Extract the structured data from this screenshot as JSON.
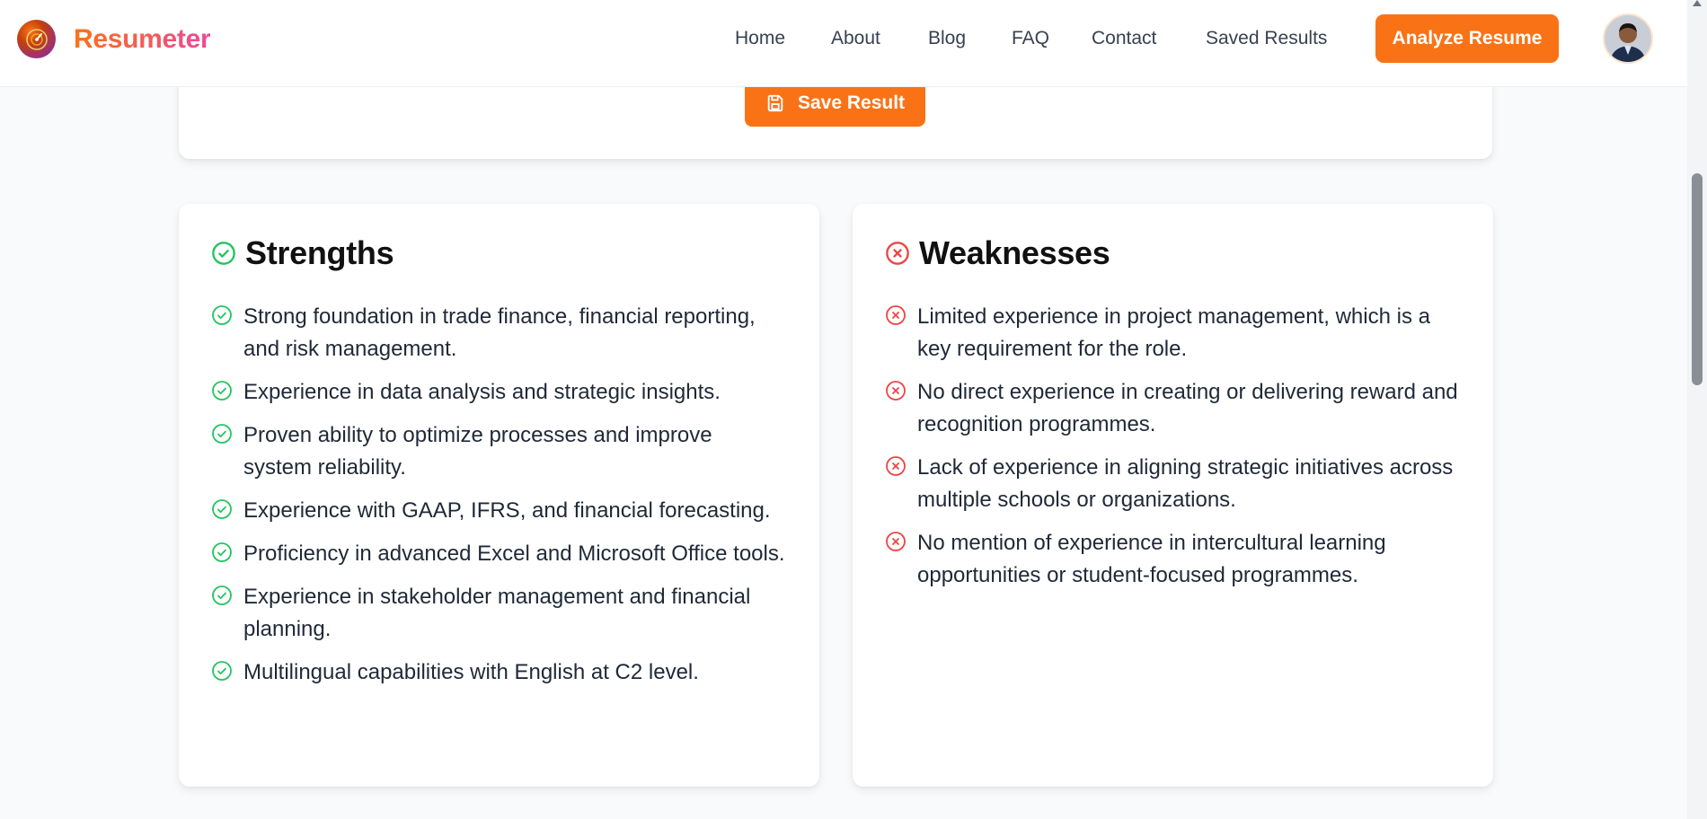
{
  "brand": {
    "name": "Resumeter",
    "accent": "#f97316",
    "secondary": "#ec4899"
  },
  "nav": {
    "links": [
      "Home",
      "About",
      "Blog",
      "FAQ",
      "Contact",
      "Saved Results"
    ],
    "cta_label": "Analyze Resume",
    "avatar_icon": "user-avatar"
  },
  "result": {
    "save_label": "Save Result",
    "save_icon": "floppy-disk-icon"
  },
  "strengths": {
    "title": "Strengths",
    "icon": "check-circle-icon",
    "color": "#22c55e",
    "items": [
      "Strong foundation in trade finance, financial reporting, and risk management.",
      "Experience in data analysis and strategic insights.",
      "Proven ability to optimize processes and improve system reliability.",
      "Experience with GAAP, IFRS, and financial forecasting.",
      "Proficiency in advanced Excel and Microsoft Office tools.",
      "Experience in stakeholder management and financial planning.",
      "Multilingual capabilities with English at C2 level."
    ]
  },
  "weaknesses": {
    "title": "Weaknesses",
    "icon": "x-circle-icon",
    "color": "#ef4444",
    "items": [
      "Limited experience in project management, which is a key requirement for the role.",
      "No direct experience in creating or delivering reward and recognition programmes.",
      "Lack of experience in aligning strategic initiatives across multiple schools or organizations.",
      "No mention of experience in intercultural learning opportunities or student-focused programmes."
    ]
  }
}
